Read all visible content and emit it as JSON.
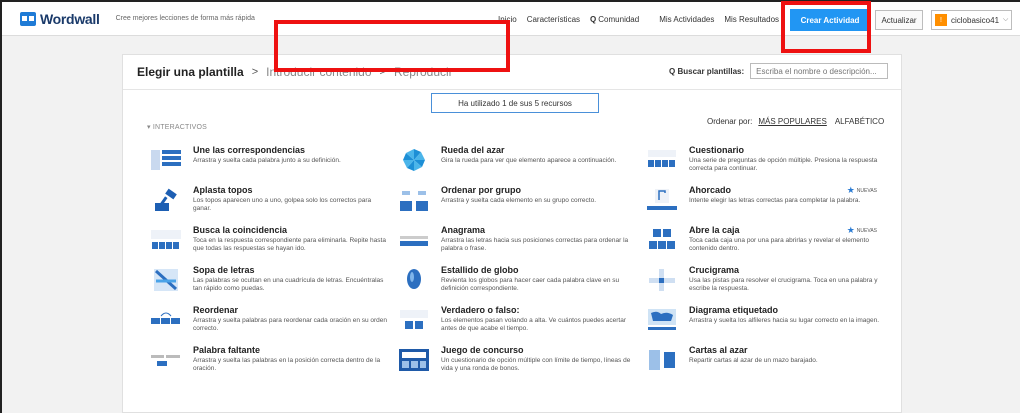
{
  "brand": {
    "name": "Wordwall",
    "tagline": "Cree mejores lecciones de forma más rápida"
  },
  "nav": {
    "inicio": "Inicio",
    "caracteristicas": "Características",
    "comunidad": "Comunidad",
    "mis_actividades": "Mis Actividades",
    "mis_resultados": "Mis Resultados",
    "crear": "Crear Actividad",
    "actualizar": "Actualizar",
    "user_badge": "!",
    "user": "ciclobasico41"
  },
  "steps": {
    "step1": "Elegir una plantilla",
    "step2": "Introducir contenido",
    "step3": "Reproducir"
  },
  "search": {
    "label": "Buscar plantillas:",
    "placeholder": "Escriba el nombre o descripción..."
  },
  "usage": "Ha utilizado 1 de sus 5 recursos",
  "section": "▾ INTERACTIVOS",
  "sort": {
    "label": "Ordenar por:",
    "popular": "MÁS POPULARES",
    "alpha": "ALFABÉTICO"
  },
  "new_label": "NUEVAS",
  "templates": [
    {
      "title": "Une las correspondencias",
      "desc": "Arrastra y suelta cada palabra junto a su definición.",
      "icon": "match-icon"
    },
    {
      "title": "Rueda del azar",
      "desc": "Gira la rueda para ver que elemento aparece a continuación.",
      "icon": "wheel-icon"
    },
    {
      "title": "Cuestionario",
      "desc": "Una serie de preguntas de opción múltiple. Presiona la respuesta correcta para continuar.",
      "icon": "quiz-icon"
    },
    {
      "title": "Aplasta topos",
      "desc": "Los topos aparecen uno a uno, golpea solo los correctos para ganar.",
      "icon": "hammer-icon"
    },
    {
      "title": "Ordenar por grupo",
      "desc": "Arrastra y suelta cada elemento en su grupo correcto.",
      "icon": "group-sort-icon"
    },
    {
      "title": "Ahorcado",
      "desc": "Intente elegir las letras correctas para completar la palabra.",
      "icon": "hangman-icon",
      "new": true
    },
    {
      "title": "Busca la coincidencia",
      "desc": "Toca en la respuesta correspondiente para eliminarla. Repite hasta que todas las respuestas se hayan ido.",
      "icon": "find-match-icon"
    },
    {
      "title": "Anagrama",
      "desc": "Arrastra las letras hacia sus posiciones correctas para ordenar la palabra o frase.",
      "icon": "anagram-icon"
    },
    {
      "title": "Abre la caja",
      "desc": "Toca cada caja una por una para abrirlas y revelar el elemento contenido dentro.",
      "icon": "open-box-icon",
      "new": true
    },
    {
      "title": "Sopa de letras",
      "desc": "Las palabras se ocultan en una cuadrícula de letras. Encuéntralas tan rápido como puedas.",
      "icon": "wordsearch-icon"
    },
    {
      "title": "Estallido de globo",
      "desc": "Revienta los globos para hacer caer cada palabra clave en su definición correspondiente.",
      "icon": "balloon-icon"
    },
    {
      "title": "Crucigrama",
      "desc": "Usa las pistas para resolver el crucigrama. Toca en una palabra y escribe la respuesta.",
      "icon": "crossword-icon"
    },
    {
      "title": "Reordenar",
      "desc": "Arrastra y suelta palabras para reordenar cada oración en su orden correcto.",
      "icon": "reorder-icon"
    },
    {
      "title": "Verdadero o falso:",
      "desc": "Los elementos pasan volando a alta. Ve cuántos puedes acertar antes de que acabe el tiempo.",
      "icon": "true-false-icon"
    },
    {
      "title": "Diagrama etiquetado",
      "desc": "Arrastra y suelta los alfileres hacia su lugar correcto en la imagen.",
      "icon": "diagram-icon"
    },
    {
      "title": "Palabra faltante",
      "desc": "Arrastra y suelta las palabras en la posición correcta dentro de la oración.",
      "icon": "missing-word-icon"
    },
    {
      "title": "Juego de concurso",
      "desc": "Un cuestionario de opción múltiple con límite de tiempo, líneas de vida y una ronda de bonos.",
      "icon": "gameshow-icon"
    },
    {
      "title": "Cartas al azar",
      "desc": "Repartir cartas al azar de un mazo barajado.",
      "icon": "cards-icon"
    }
  ],
  "colors": {
    "primary": "#2196f3",
    "highlight": "#ee1111",
    "brand": "#1a3a6a"
  }
}
